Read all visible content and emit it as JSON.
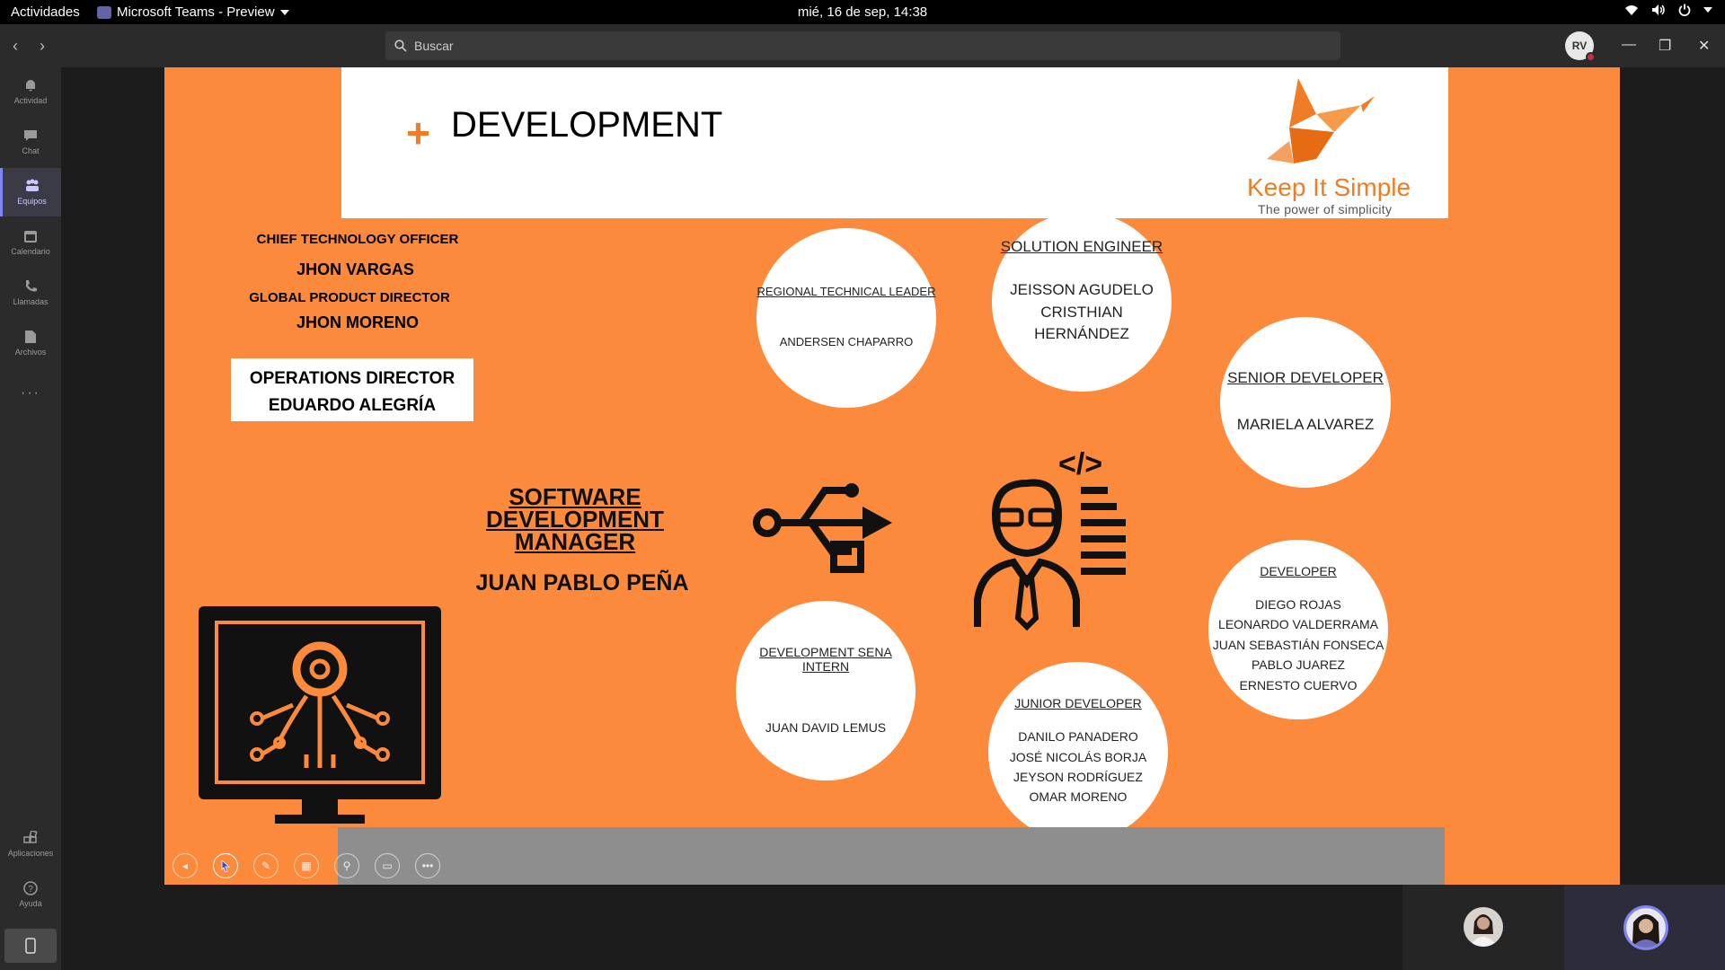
{
  "topbar": {
    "activities": "Actividades",
    "app_name": "Microsoft Teams - Preview",
    "clock": "mié, 16 de sep, 14:38"
  },
  "titlebar": {
    "search_placeholder": "Buscar",
    "avatar_initials": "RV"
  },
  "rail": {
    "items": [
      {
        "label": "Actividad",
        "icon": "bell-icon"
      },
      {
        "label": "Chat",
        "icon": "chat-icon"
      },
      {
        "label": "Equipos",
        "icon": "teams-icon"
      },
      {
        "label": "Calendario",
        "icon": "calendar-icon"
      },
      {
        "label": "Llamadas",
        "icon": "phone-icon"
      },
      {
        "label": "Archivos",
        "icon": "file-icon"
      }
    ],
    "more": "···",
    "apps": "Aplicaciones",
    "help": "Ayuda",
    "active_index": 2
  },
  "slide": {
    "title": "DEVELOPMENT",
    "plus": "+",
    "logo_text": "Keep It Simple",
    "logo_sub": "The power of simplicity",
    "cto_role": "CHIEF TECHNOLOGY OFFICER",
    "cto_name": "JHON VARGAS",
    "gpd_role": "GLOBAL PRODUCT DIRECTOR",
    "gpd_name": "JHON MORENO",
    "ops_role": "OPERATIONS DIRECTOR",
    "ops_name": "EDUARDO ALEGRÍA",
    "sdm_role": "SOFTWARE DEVELOPMENT MANAGER",
    "sdm_name": "JUAN PABLO PEÑA",
    "code_tag": "</>",
    "circles": {
      "rtl": {
        "role": "REGIONAL TECHNICAL LEADER",
        "names": "ANDERSEN CHAPARRO"
      },
      "se": {
        "role": "SOLUTION ENGINEER",
        "names": "JEISSON AGUDELO\nCRISTHIAN HERNÁNDEZ"
      },
      "sd": {
        "role": "SENIOR DEVELOPER",
        "names": "MARIELA ALVAREZ"
      },
      "dev": {
        "role": "DEVELOPER",
        "names": "DIEGO ROJAS\nLEONARDO VALDERRAMA\nJUAN SEBASTIÁN FONSECA\nPABLO JUAREZ\nERNESTO CUERVO"
      },
      "intern": {
        "role": "DEVELOPMENT SENA INTERN",
        "names": "JUAN DAVID LEMUS"
      },
      "jr": {
        "role": "JUNIOR DEVELOPER",
        "names": "DANILO PANADERO\nJOSÉ NICOLÁS BORJA\nJEYSON RODRÍGUEZ\nOMAR MORENO"
      }
    }
  },
  "presentation_controls": [
    "previous-icon",
    "pointer-icon",
    "pen-icon",
    "slides-grid-icon",
    "zoom-icon",
    "presenter-view-icon",
    "more-icon"
  ],
  "colors": {
    "slide_orange": "#fb8a3c",
    "accent_purple": "#7f85f5",
    "logo_orange": "#f07c25"
  }
}
